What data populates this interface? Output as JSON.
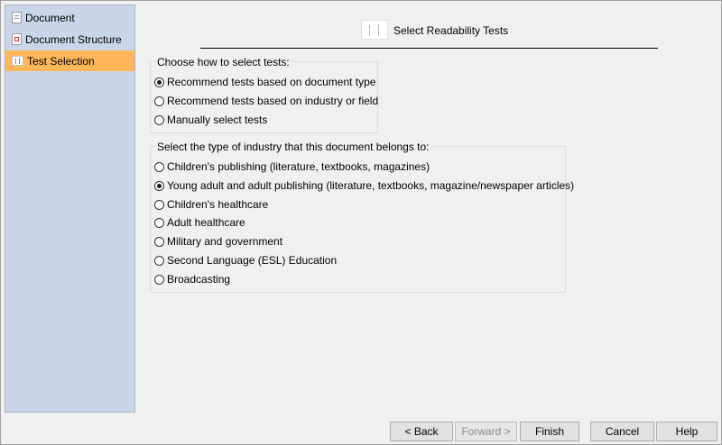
{
  "sidebar": {
    "items": [
      {
        "label": "Document",
        "icon": "document-icon",
        "selected": false
      },
      {
        "label": "Document Structure",
        "icon": "document-structure-icon",
        "selected": false
      },
      {
        "label": "Test Selection",
        "icon": "test-selection-icon",
        "selected": true
      }
    ],
    "selected_color": "#ffb759",
    "background_color": "#c9d6ea"
  },
  "header": {
    "title": "Select Readability Tests",
    "icon": "readability-tests-icon"
  },
  "selection_method": {
    "label": "Choose how to select tests:",
    "options": [
      "Recommend tests based on document type",
      "Recommend tests based on industry or field",
      "Manually select tests"
    ],
    "selected": "Recommend tests based on document type"
  },
  "industry": {
    "label": "Select the type of industry that this document belongs to:",
    "options": [
      "Children's publishing (literature, textbooks, magazines)",
      "Young adult and adult publishing (literature, textbooks, magazine/newspaper articles)",
      "Children's healthcare",
      "Adult healthcare",
      "Military and government",
      "Second Language (ESL) Education",
      "Broadcasting"
    ],
    "selected": "Young adult and adult publishing (literature, textbooks, magazine/newspaper articles)"
  },
  "buttons": {
    "back": "< Back",
    "forward": "Forward >",
    "forward_enabled": false,
    "finish": "Finish",
    "cancel": "Cancel",
    "help": "Help"
  }
}
